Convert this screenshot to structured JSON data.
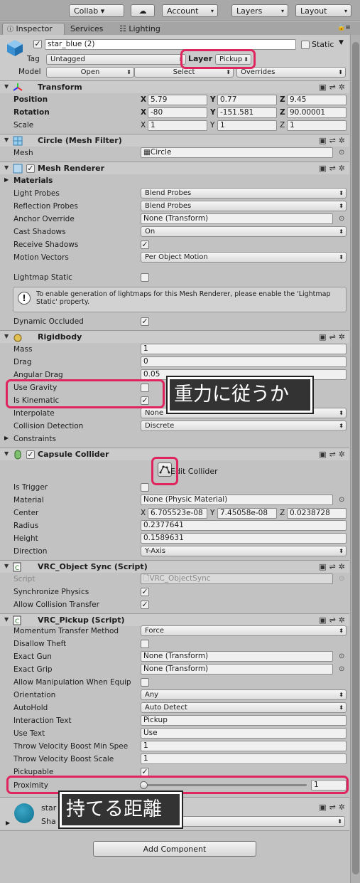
{
  "toolbar": {
    "collab": "Collab ▾",
    "account": "Account",
    "layers": "Layers",
    "layout": "Layout"
  },
  "tabs": {
    "inspector": "Inspector",
    "services": "Services",
    "lighting": "Lighting"
  },
  "object": {
    "name": "star_blue (2)",
    "static_label": "Static",
    "tag_label": "Tag",
    "tag_value": "Untagged",
    "layer_label": "Layer",
    "layer_value": "Pickup",
    "model_label": "Model",
    "open": "Open",
    "select": "Select",
    "overrides": "Overrides"
  },
  "transform": {
    "title": "Transform",
    "position_label": "Position",
    "rotation_label": "Rotation",
    "scale_label": "Scale",
    "position": {
      "x": "5.79",
      "y": "0.77",
      "z": "9.45"
    },
    "rotation": {
      "x": "-80",
      "y": "-151.581",
      "z": "90.00001"
    },
    "scale": {
      "x": "1",
      "y": "1",
      "z": "1"
    },
    "x": "X",
    "y": "Y",
    "z": "Z"
  },
  "mesh_filter": {
    "title": "Circle (Mesh Filter)",
    "mesh_label": "Mesh",
    "mesh_value": "Circle"
  },
  "mesh_renderer": {
    "title": "Mesh Renderer",
    "materials": "Materials",
    "light_probes_label": "Light Probes",
    "light_probes": "Blend Probes",
    "reflection_probes_label": "Reflection Probes",
    "reflection_probes": "Blend Probes",
    "anchor_override_label": "Anchor Override",
    "anchor_override": "None (Transform)",
    "cast_shadows_label": "Cast Shadows",
    "cast_shadows": "On",
    "receive_shadows_label": "Receive Shadows",
    "motion_vectors_label": "Motion Vectors",
    "motion_vectors": "Per Object Motion",
    "lightmap_static_label": "Lightmap Static",
    "info": "To enable generation of lightmaps for this Mesh Renderer, please enable the 'Lightmap Static' property.",
    "dynamic_occluded_label": "Dynamic Occluded"
  },
  "rigidbody": {
    "title": "Rigidbody",
    "mass_label": "Mass",
    "mass": "1",
    "drag_label": "Drag",
    "drag": "0",
    "angular_drag_label": "Angular Drag",
    "angular_drag": "0.05",
    "use_gravity_label": "Use Gravity",
    "is_kinematic_label": "Is Kinematic",
    "interpolate_label": "Interpolate",
    "interpolate": "None",
    "collision_detection_label": "Collision Detection",
    "collision_detection": "Discrete",
    "constraints_label": "Constraints"
  },
  "capsule": {
    "title": "Capsule Collider",
    "edit": "Edit Collider",
    "is_trigger_label": "Is Trigger",
    "material_label": "Material",
    "material": "None (Physic Material)",
    "center_label": "Center",
    "center": {
      "x": "6.705523e-08",
      "y": "7.45058e-08",
      "z": "0.0238728"
    },
    "radius_label": "Radius",
    "radius": "0.2377641",
    "height_label": "Height",
    "height": "0.1589631",
    "direction_label": "Direction",
    "direction": "Y-Axis"
  },
  "object_sync": {
    "title": "VRC_Object Sync (Script)",
    "script_label": "Script",
    "script": "VRC_ObjectSync",
    "sync_physics_label": "Synchronize Physics",
    "allow_collision_label": "Allow Collision Transfer"
  },
  "pickup": {
    "title": "VRC_Pickup (Script)",
    "momentum_label": "Momentum Transfer Method",
    "momentum": "Force",
    "disallow_theft_label": "Disallow Theft",
    "exact_gun_label": "Exact Gun",
    "exact_gun": "None (Transform)",
    "exact_grip_label": "Exact Grip",
    "exact_grip": "None (Transform)",
    "allow_manip_label": "Allow Manipulation When Equip",
    "orientation_label": "Orientation",
    "orientation": "Any",
    "autohold_label": "AutoHold",
    "autohold": "Auto Detect",
    "interaction_text_label": "Interaction Text",
    "interaction_text": "Pickup",
    "use_text_label": "Use Text",
    "use_text": "Use",
    "throw_min_label": "Throw Velocity Boost Min Spee",
    "throw_min": "1",
    "throw_scale_label": "Throw Velocity Boost Scale",
    "throw_scale": "1",
    "pickupable_label": "Pickupable",
    "proximity_label": "Proximity",
    "proximity": "1"
  },
  "material": {
    "name": "star",
    "shader_label": "Sha"
  },
  "add_component": "Add Component",
  "callouts": {
    "gravity": "重力に従うか",
    "proximity": "持てる距離"
  },
  "colors": {
    "highlight": "#e0245e",
    "panel": "#c2c2c2"
  }
}
